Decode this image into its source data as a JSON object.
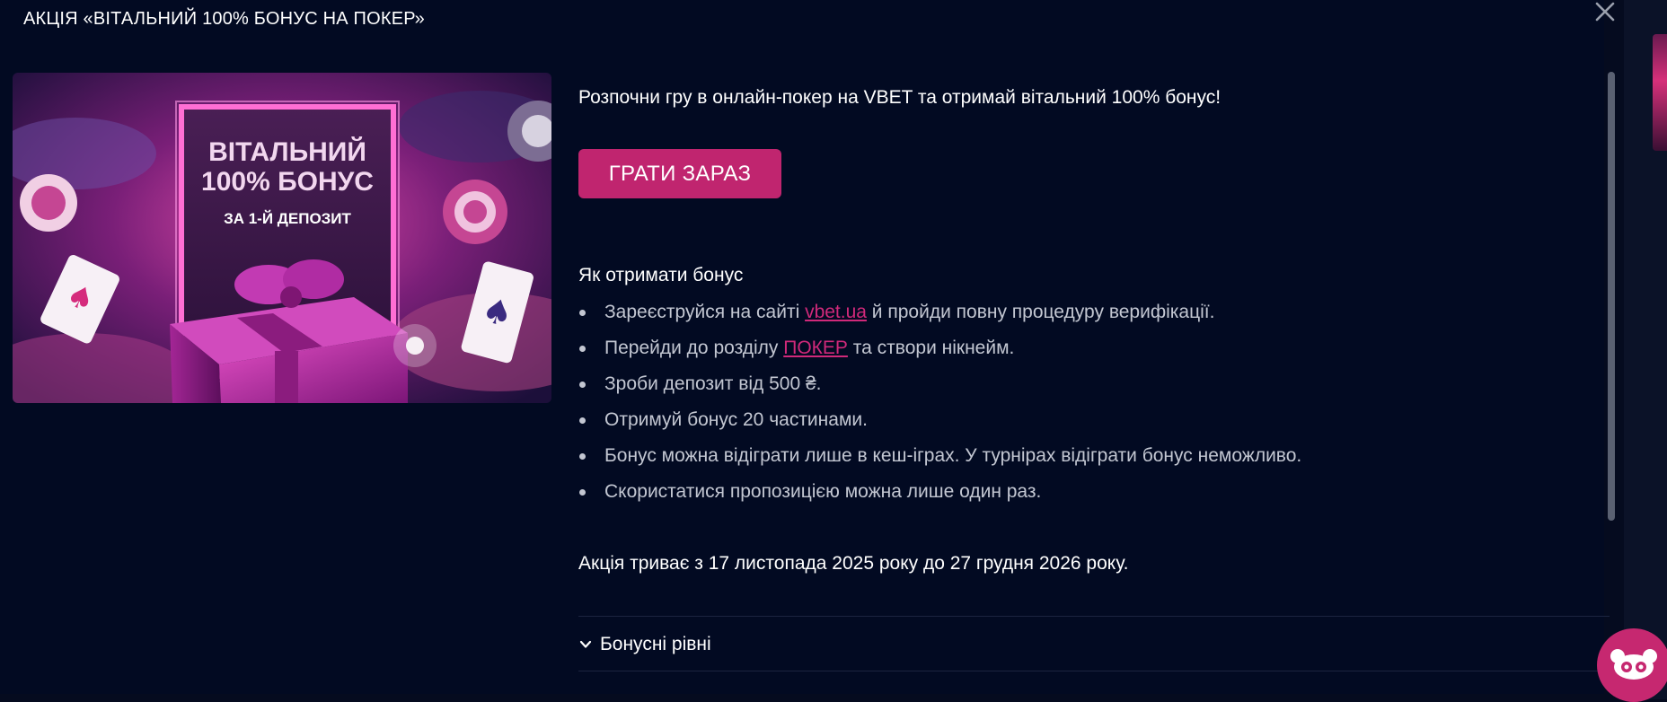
{
  "modal": {
    "title": "АКЦІЯ «ВІТАЛЬНИЙ 100% БОНУС НА ПОКЕР»",
    "close_icon": "close-icon"
  },
  "banner": {
    "heading_line1": "ВІТАЛЬНИЙ",
    "heading_line2": "100% БОНУС",
    "subheading": "ЗА 1-Й ДЕПОЗИТ"
  },
  "content": {
    "intro": "Розпочни гру в онлайн-покер на VBET та отримай вітальний 100% бонус!",
    "play_button": "ГРАТИ ЗАРАЗ",
    "how_title": "Як отримати бонус",
    "steps": [
      {
        "before": "Зареєструйся на сайті ",
        "link": "vbet.ua",
        "after": " й пройди повну процедуру верифікації."
      },
      {
        "before": "Перейди до розділу ",
        "link": "ПОКЕР",
        "after": " та створи нікнейм."
      },
      {
        "text": "Зроби депозит від 500 ₴."
      },
      {
        "text": "Отримуй бонус 20 частинами."
      },
      {
        "text": "Бонус можна відіграти лише в кеш-іграх. У турнірах відіграти бонус неможливо."
      },
      {
        "text": "Скористатися пропозицією можна лише один раз."
      }
    ],
    "period": "Акція триває з 17 листопада 2025 року до 27 грудня 2026 року.",
    "accordion_label": "Бонусні рівні",
    "accordion_icon": "chevron-down-icon"
  },
  "chat": {
    "icon": "chat-mascot-icon"
  },
  "colors": {
    "background": "#020a22",
    "accent": "#c0256f",
    "link": "#d0297a",
    "muted_text": "#c3c7d2"
  }
}
